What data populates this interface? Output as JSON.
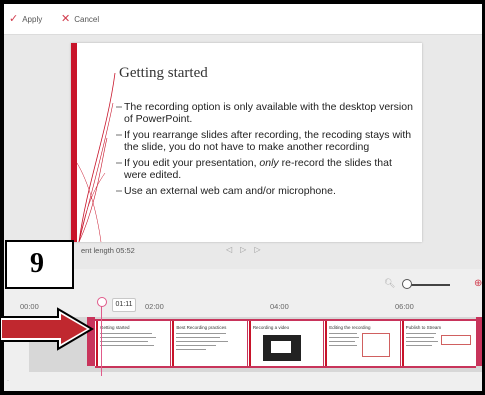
{
  "toolbar": {
    "apply_label": "Apply",
    "cancel_label": "Cancel"
  },
  "slide": {
    "title": "Getting started",
    "bullets": [
      "The recording option is only available with the desktop version of PowerPoint.",
      "If you rearrange slides after recording, the recoding stays with the slide, you do not have to make another recording",
      "If you edit your presentation, only re-record the slides that were edited.",
      "Use an external web cam and/or microphone."
    ],
    "bullet3_pre": "If you edit your presentation, ",
    "bullet3_em": "only",
    "bullet3_post": " re-record the slides that were edited."
  },
  "media": {
    "segment_length": "ent length 05:52"
  },
  "callout": {
    "number": "9"
  },
  "timeline": {
    "current_time": "01:11",
    "ticks": [
      "00:00",
      "02:00",
      "04:00",
      "06:00"
    ],
    "thumbnails": [
      {
        "title": "Getting started"
      },
      {
        "title": "Best Recording practices"
      },
      {
        "title": "Recording a video"
      },
      {
        "title": "Editing the recording"
      },
      {
        "title": "Publish to Stream"
      }
    ]
  },
  "colors": {
    "accent": "#d13b4c",
    "clip_border": "#c8345b",
    "slide_bar": "#c8142a",
    "arrow": "#c0282f"
  },
  "icons": {
    "apply": "check-icon",
    "cancel": "close-icon",
    "zoom_out": "zoom-out-icon",
    "zoom_in": "zoom-in-icon"
  }
}
